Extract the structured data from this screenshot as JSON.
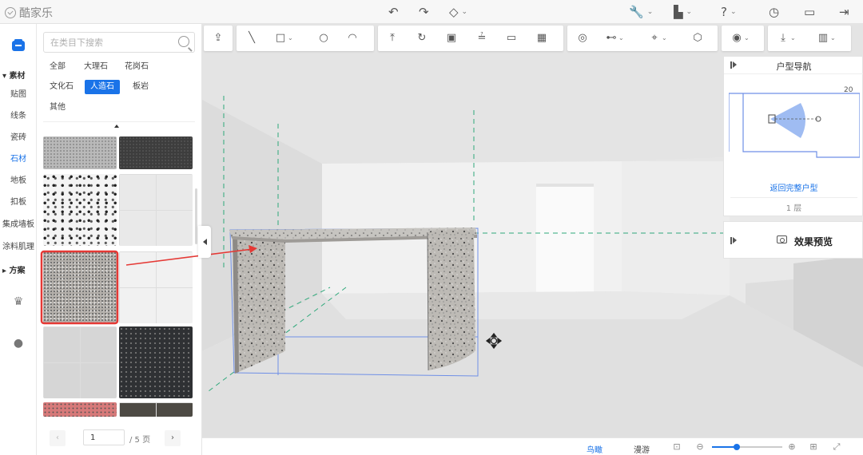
{
  "app": {
    "title": "酷家乐"
  },
  "topbar": {
    "icons": [
      "undo-icon",
      "redo-icon",
      "eraser-icon",
      "wrench-icon",
      "save-icon",
      "help-icon",
      "history-icon",
      "document-icon",
      "exit-icon"
    ]
  },
  "rail": {
    "section_material": "素材",
    "items": [
      {
        "label": "贴图",
        "active": false
      },
      {
        "label": "线条",
        "active": false
      },
      {
        "label": "瓷砖",
        "active": false
      },
      {
        "label": "石材",
        "active": true
      },
      {
        "label": "地板",
        "active": false
      },
      {
        "label": "扣板",
        "active": false
      },
      {
        "label": "集成墙板",
        "active": false
      },
      {
        "label": "涂料肌理",
        "active": false
      }
    ],
    "section_plan": "方案"
  },
  "panel": {
    "search_placeholder": "在类目下搜索",
    "tags": [
      {
        "label": "全部",
        "active": false
      },
      {
        "label": "大理石",
        "active": false
      },
      {
        "label": "花岗石",
        "active": false
      },
      {
        "label": "文化石",
        "active": false
      },
      {
        "label": "人造石",
        "active": true
      },
      {
        "label": "板岩",
        "active": false
      },
      {
        "label": "其他",
        "active": false
      }
    ],
    "selected_swatch_index": 4,
    "pagination": {
      "current": "1",
      "total": "/ 5 页"
    }
  },
  "nav_panel": {
    "title": "户型导航",
    "map_value": "20",
    "back_link": "返回完整户型",
    "floor": "1 层"
  },
  "preview_panel": {
    "label": "效果预览"
  },
  "bottombar": {
    "views": [
      {
        "label": "鸟瞰",
        "active": true
      },
      {
        "label": "漫游",
        "active": false
      }
    ],
    "zoom_level": 0.35
  },
  "colors": {
    "accent": "#1a73e8",
    "annotation": "#e53935",
    "selection": "#6f8fe6",
    "guide": "#2ea87a"
  }
}
